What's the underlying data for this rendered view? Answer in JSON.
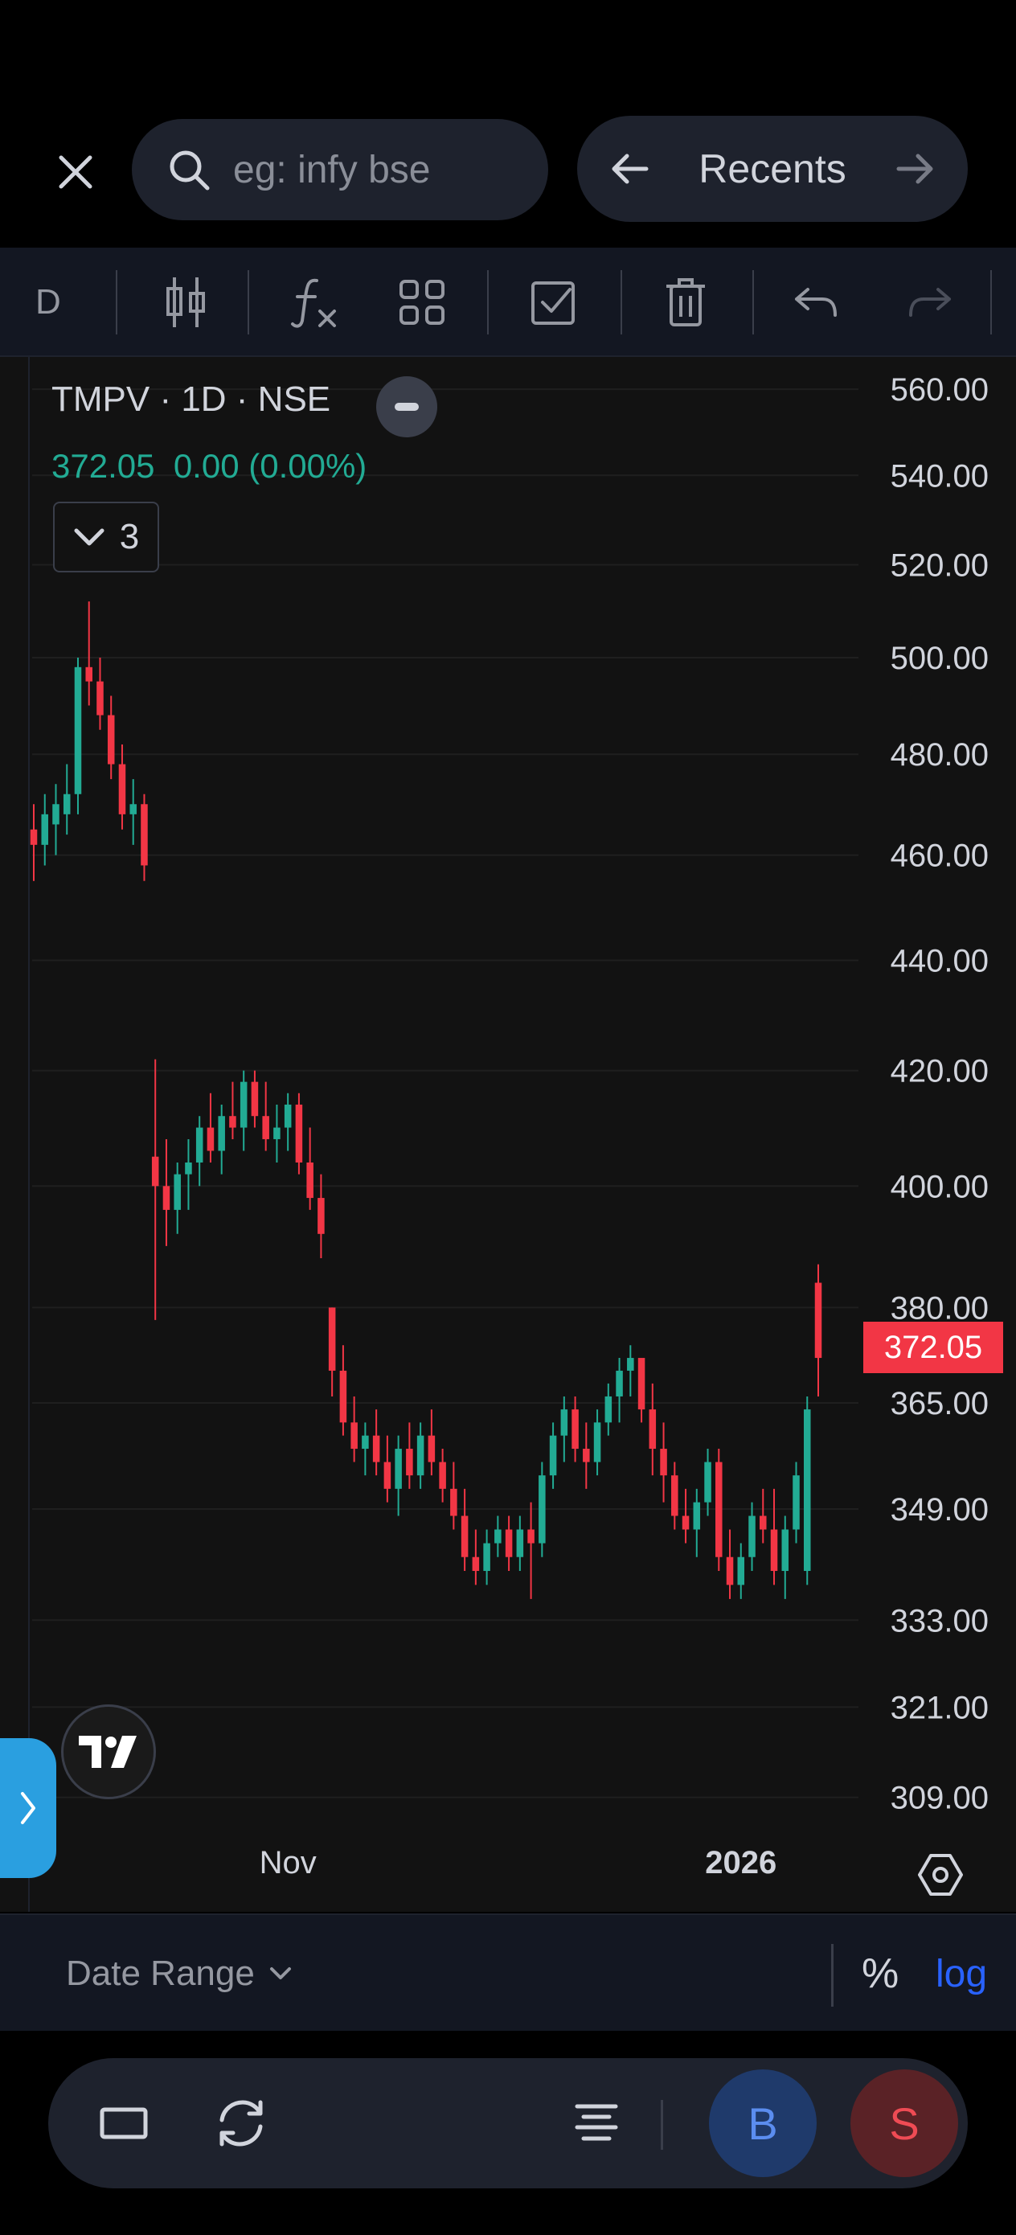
{
  "search": {
    "placeholder": "eg: infy bse"
  },
  "recents": {
    "label": "Recents"
  },
  "toolbar": {
    "interval": "D"
  },
  "legend": {
    "symbol": "TMPV",
    "interval": "1D",
    "exchange": "NSE",
    "title": "TMPV · 1D · NSE",
    "last": "372.05",
    "change": "0.00",
    "change_pct": "(0.00%)",
    "indicator_count": "3"
  },
  "price_tag": "372.05",
  "range_bar": {
    "date_range": "Date Range",
    "percent": "%",
    "log": "log"
  },
  "bottom": {
    "buy": "B",
    "sell": "S"
  },
  "colors": {
    "up": "#22ab94",
    "down": "#f23645",
    "accent": "#2962ff",
    "background": "#121212"
  },
  "chart_data": {
    "type": "candlestick",
    "scale": "log",
    "grid": true,
    "ylim": [
      305,
      565
    ],
    "y_ticks": [
      "560.00",
      "540.00",
      "520.00",
      "500.00",
      "480.00",
      "460.00",
      "440.00",
      "420.00",
      "400.00",
      "380.00",
      "365.00",
      "349.00",
      "333.00",
      "321.00",
      "309.00"
    ],
    "x_ticks": [
      {
        "label": "Nov",
        "bold": false,
        "bar": 23
      },
      {
        "label": "2026",
        "bold": true,
        "bar": 64
      }
    ],
    "candles": [
      [
        465,
        470,
        455,
        462
      ],
      [
        462,
        472,
        458,
        468
      ],
      [
        466,
        474,
        460,
        470
      ],
      [
        468,
        478,
        464,
        472
      ],
      [
        472,
        500,
        468,
        498
      ],
      [
        498,
        512,
        490,
        495
      ],
      [
        495,
        500,
        485,
        488
      ],
      [
        488,
        492,
        475,
        478
      ],
      [
        478,
        482,
        465,
        468
      ],
      [
        468,
        475,
        462,
        470
      ],
      [
        470,
        472,
        455,
        458
      ],
      [
        405,
        422,
        378,
        400
      ],
      [
        400,
        408,
        390,
        396
      ],
      [
        396,
        404,
        392,
        402
      ],
      [
        402,
        408,
        396,
        404
      ],
      [
        404,
        412,
        400,
        410
      ],
      [
        410,
        416,
        404,
        406
      ],
      [
        406,
        414,
        402,
        412
      ],
      [
        412,
        418,
        408,
        410
      ],
      [
        410,
        420,
        406,
        418
      ],
      [
        418,
        420,
        410,
        412
      ],
      [
        412,
        418,
        406,
        408
      ],
      [
        408,
        414,
        404,
        410
      ],
      [
        410,
        416,
        406,
        414
      ],
      [
        414,
        416,
        402,
        404
      ],
      [
        404,
        410,
        396,
        398
      ],
      [
        398,
        402,
        388,
        392
      ],
      [
        380,
        380,
        366,
        370
      ],
      [
        370,
        374,
        360,
        362
      ],
      [
        362,
        366,
        356,
        358
      ],
      [
        358,
        362,
        354,
        360
      ],
      [
        360,
        364,
        354,
        356
      ],
      [
        356,
        360,
        350,
        352
      ],
      [
        352,
        360,
        348,
        358
      ],
      [
        358,
        362,
        352,
        354
      ],
      [
        354,
        362,
        352,
        360
      ],
      [
        360,
        364,
        354,
        356
      ],
      [
        356,
        358,
        350,
        352
      ],
      [
        352,
        356,
        346,
        348
      ],
      [
        348,
        352,
        340,
        342
      ],
      [
        342,
        346,
        338,
        340
      ],
      [
        340,
        346,
        338,
        344
      ],
      [
        344,
        348,
        342,
        346
      ],
      [
        346,
        348,
        340,
        342
      ],
      [
        342,
        348,
        340,
        346
      ],
      [
        346,
        350,
        336,
        344
      ],
      [
        344,
        356,
        342,
        354
      ],
      [
        354,
        362,
        352,
        360
      ],
      [
        360,
        366,
        356,
        364
      ],
      [
        364,
        366,
        356,
        358
      ],
      [
        358,
        362,
        352,
        356
      ],
      [
        356,
        364,
        354,
        362
      ],
      [
        362,
        368,
        360,
        366
      ],
      [
        366,
        372,
        362,
        370
      ],
      [
        370,
        374,
        366,
        372
      ],
      [
        372,
        370,
        362,
        364
      ],
      [
        364,
        368,
        354,
        358
      ],
      [
        358,
        362,
        350,
        354
      ],
      [
        354,
        356,
        346,
        348
      ],
      [
        348,
        352,
        344,
        346
      ],
      [
        346,
        352,
        342,
        350
      ],
      [
        350,
        358,
        348,
        356
      ],
      [
        356,
        358,
        340,
        342
      ],
      [
        342,
        346,
        336,
        338
      ],
      [
        338,
        344,
        336,
        342
      ],
      [
        342,
        350,
        340,
        348
      ],
      [
        348,
        352,
        344,
        346
      ],
      [
        346,
        352,
        338,
        340
      ],
      [
        340,
        348,
        336,
        346
      ],
      [
        346,
        356,
        344,
        354
      ],
      [
        340,
        366,
        338,
        364
      ],
      [
        384,
        387,
        366,
        372
      ]
    ]
  }
}
